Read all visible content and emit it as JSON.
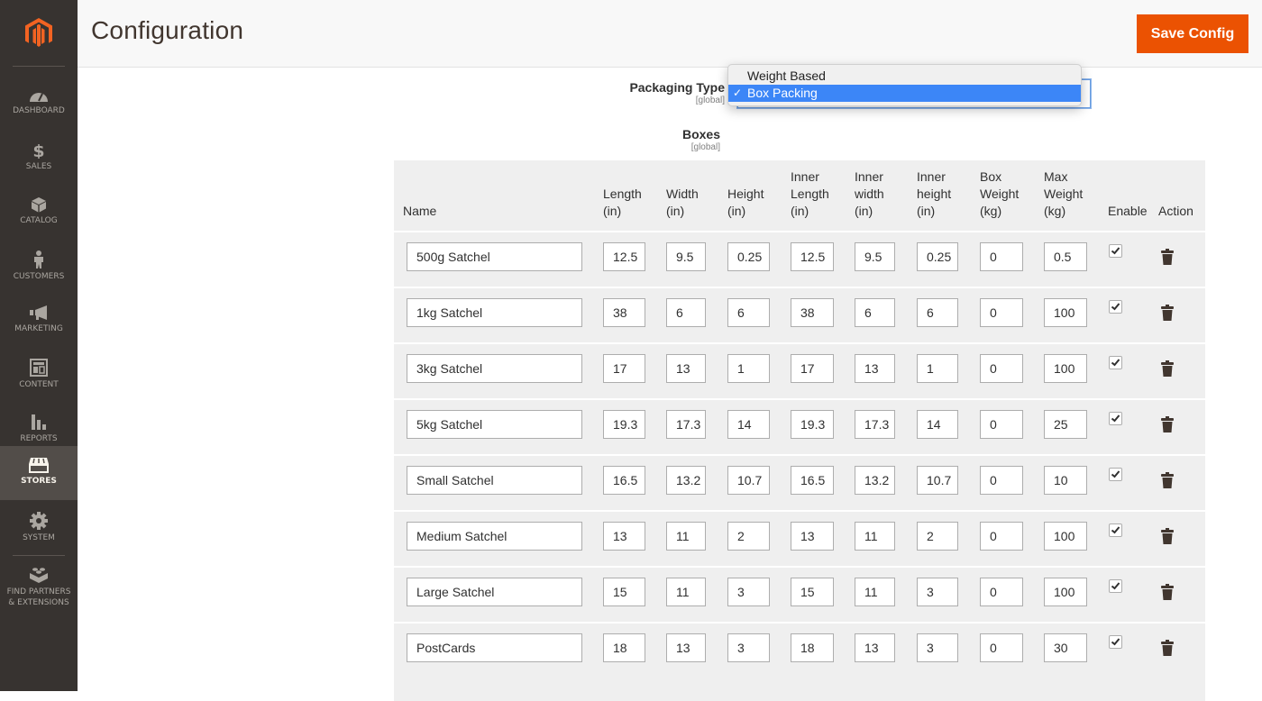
{
  "sidebar": {
    "items": [
      {
        "label": "Dashboard",
        "icon": "dashboard-icon"
      },
      {
        "label": "Sales",
        "icon": "dollar-icon"
      },
      {
        "label": "Catalog",
        "icon": "box-icon"
      },
      {
        "label": "Customers",
        "icon": "person-icon"
      },
      {
        "label": "Marketing",
        "icon": "megaphone-icon"
      },
      {
        "label": "Content",
        "icon": "layout-icon"
      },
      {
        "label": "Reports",
        "icon": "bar-chart-icon"
      },
      {
        "label": "Stores",
        "icon": "store-icon",
        "active": true
      },
      {
        "label": "System",
        "icon": "gear-icon"
      },
      {
        "label": "Find Partners & Extensions",
        "icon": "lego-brick-icon"
      }
    ]
  },
  "header": {
    "title": "Configuration",
    "save_label": "Save Config"
  },
  "colors": {
    "accent": "#eb5202",
    "sidebar_bg": "#373330",
    "selected_option": "#3c86f7"
  },
  "packaging": {
    "label": "Packaging Type",
    "scope": "[global]",
    "selected": "Box Packing",
    "options": [
      "Weight Based",
      "Box Packing"
    ]
  },
  "boxes": {
    "label": "Boxes",
    "scope": "[global]",
    "columns": [
      "Name",
      "Length (in)",
      "Width (in)",
      "Height (in)",
      "Inner Length (in)",
      "Inner width (in)",
      "Inner height (in)",
      "Box Weight (kg)",
      "Max Weight (kg)",
      "Enable",
      "Action"
    ],
    "rows": [
      {
        "name": "500g Satchel",
        "length": "12.5",
        "width": "9.5",
        "height": "0.25",
        "inner_length": "12.5",
        "inner_width": "9.5",
        "inner_height": "0.25",
        "box_weight": "0",
        "max_weight": "0.5",
        "enabled": true
      },
      {
        "name": "1kg Satchel",
        "length": "38",
        "width": "6",
        "height": "6",
        "inner_length": "38",
        "inner_width": "6",
        "inner_height": "6",
        "box_weight": "0",
        "max_weight": "100",
        "enabled": true
      },
      {
        "name": "3kg Satchel",
        "length": "17",
        "width": "13",
        "height": "1",
        "inner_length": "17",
        "inner_width": "13",
        "inner_height": "1",
        "box_weight": "0",
        "max_weight": "100",
        "enabled": true
      },
      {
        "name": "5kg Satchel",
        "length": "19.3",
        "width": "17.3",
        "height": "14",
        "inner_length": "19.3",
        "inner_width": "17.3",
        "inner_height": "14",
        "box_weight": "0",
        "max_weight": "25",
        "enabled": true
      },
      {
        "name": "Small Satchel",
        "length": "16.5",
        "width": "13.2",
        "height": "10.7",
        "inner_length": "16.5",
        "inner_width": "13.2",
        "inner_height": "10.7",
        "box_weight": "0",
        "max_weight": "10",
        "enabled": true
      },
      {
        "name": "Medium Satchel",
        "length": "13",
        "width": "11",
        "height": "2",
        "inner_length": "13",
        "inner_width": "11",
        "inner_height": "2",
        "box_weight": "0",
        "max_weight": "100",
        "enabled": true
      },
      {
        "name": "Large Satchel",
        "length": "15",
        "width": "11",
        "height": "3",
        "inner_length": "15",
        "inner_width": "11",
        "inner_height": "3",
        "box_weight": "0",
        "max_weight": "100",
        "enabled": true
      },
      {
        "name": "PostCards",
        "length": "18",
        "width": "13",
        "height": "3",
        "inner_length": "18",
        "inner_width": "13",
        "inner_height": "3",
        "box_weight": "0",
        "max_weight": "30",
        "enabled": true
      }
    ]
  }
}
